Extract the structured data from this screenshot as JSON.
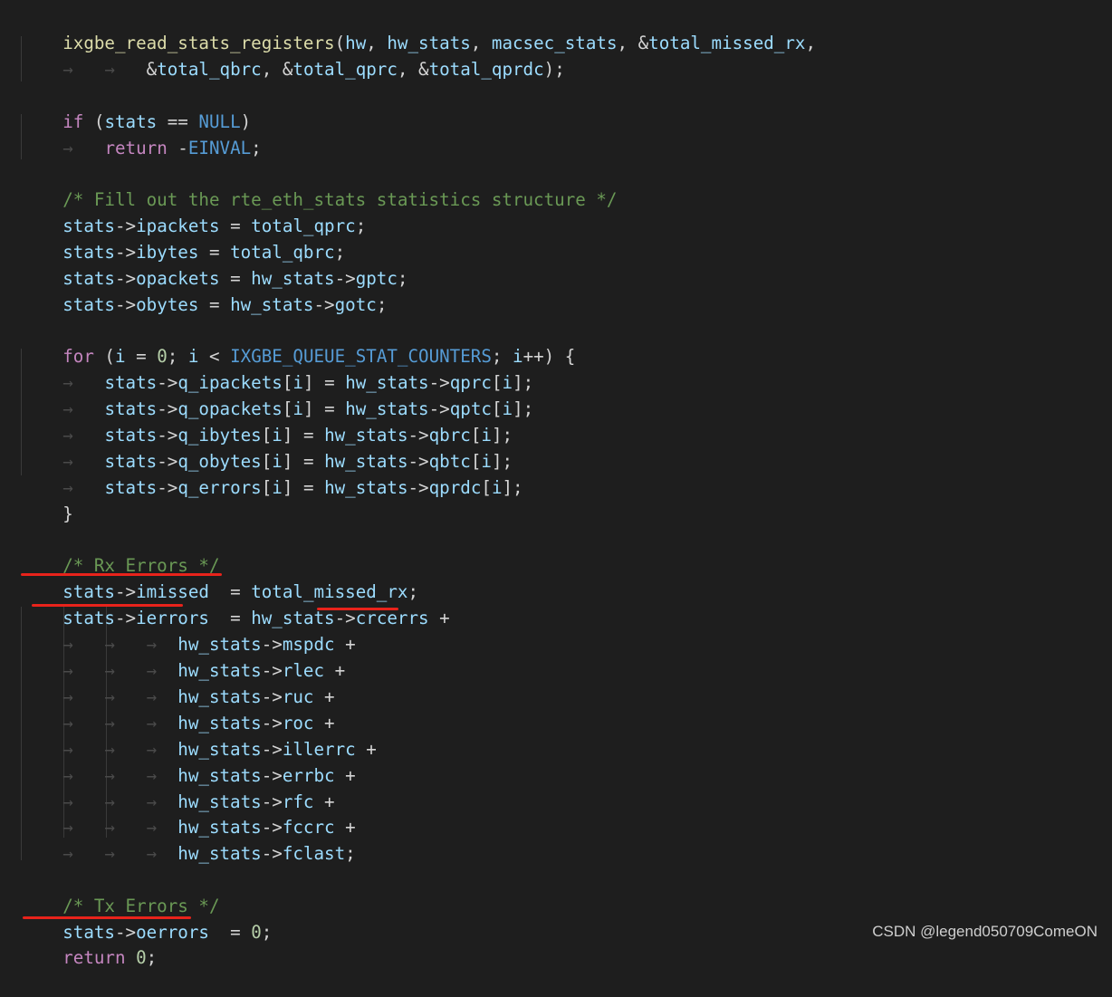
{
  "code": {
    "lines": [
      "ixgbe_read_stats_registers(hw, hw_stats, macsec_stats, &total_missed_rx,",
      "        &total_qbrc, &total_qprc, &total_qprdc);",
      "",
      "if (stats == NULL)",
      "    return -EINVAL;",
      "",
      "/* Fill out the rte_eth_stats statistics structure */",
      "stats->ipackets = total_qprc;",
      "stats->ibytes = total_qbrc;",
      "stats->opackets = hw_stats->gptc;",
      "stats->obytes = hw_stats->gotc;",
      "",
      "for (i = 0; i < IXGBE_QUEUE_STAT_COUNTERS; i++) {",
      "    stats->q_ipackets[i] = hw_stats->qprc[i];",
      "    stats->q_opackets[i] = hw_stats->qptc[i];",
      "    stats->q_ibytes[i] = hw_stats->qbrc[i];",
      "    stats->q_obytes[i] = hw_stats->qbtc[i];",
      "    stats->q_errors[i] = hw_stats->qprdc[i];",
      "}",
      "",
      "/* Rx Errors */",
      "stats->imissed  = total_missed_rx;",
      "stats->ierrors  = hw_stats->crcerrs +",
      "          hw_stats->mspdc +",
      "          hw_stats->rlec +",
      "          hw_stats->ruc +",
      "          hw_stats->roc +",
      "          hw_stats->illerrc +",
      "          hw_stats->errbc +",
      "          hw_stats->rfc +",
      "          hw_stats->fccrc +",
      "          hw_stats->fclast;",
      "",
      "/* Tx Errors */",
      "stats->oerrors  = 0;",
      "return 0;"
    ]
  },
  "watermark": "CSDN @legend050709ComeON",
  "colors": {
    "background": "#1e1e1e",
    "function": "#dcdcaa",
    "variable": "#9cdcfe",
    "keyword": "#c586c0",
    "constant": "#569cd6",
    "number": "#b5cea8",
    "comment": "#6a9955",
    "annotation_underline": "#e8231b"
  }
}
